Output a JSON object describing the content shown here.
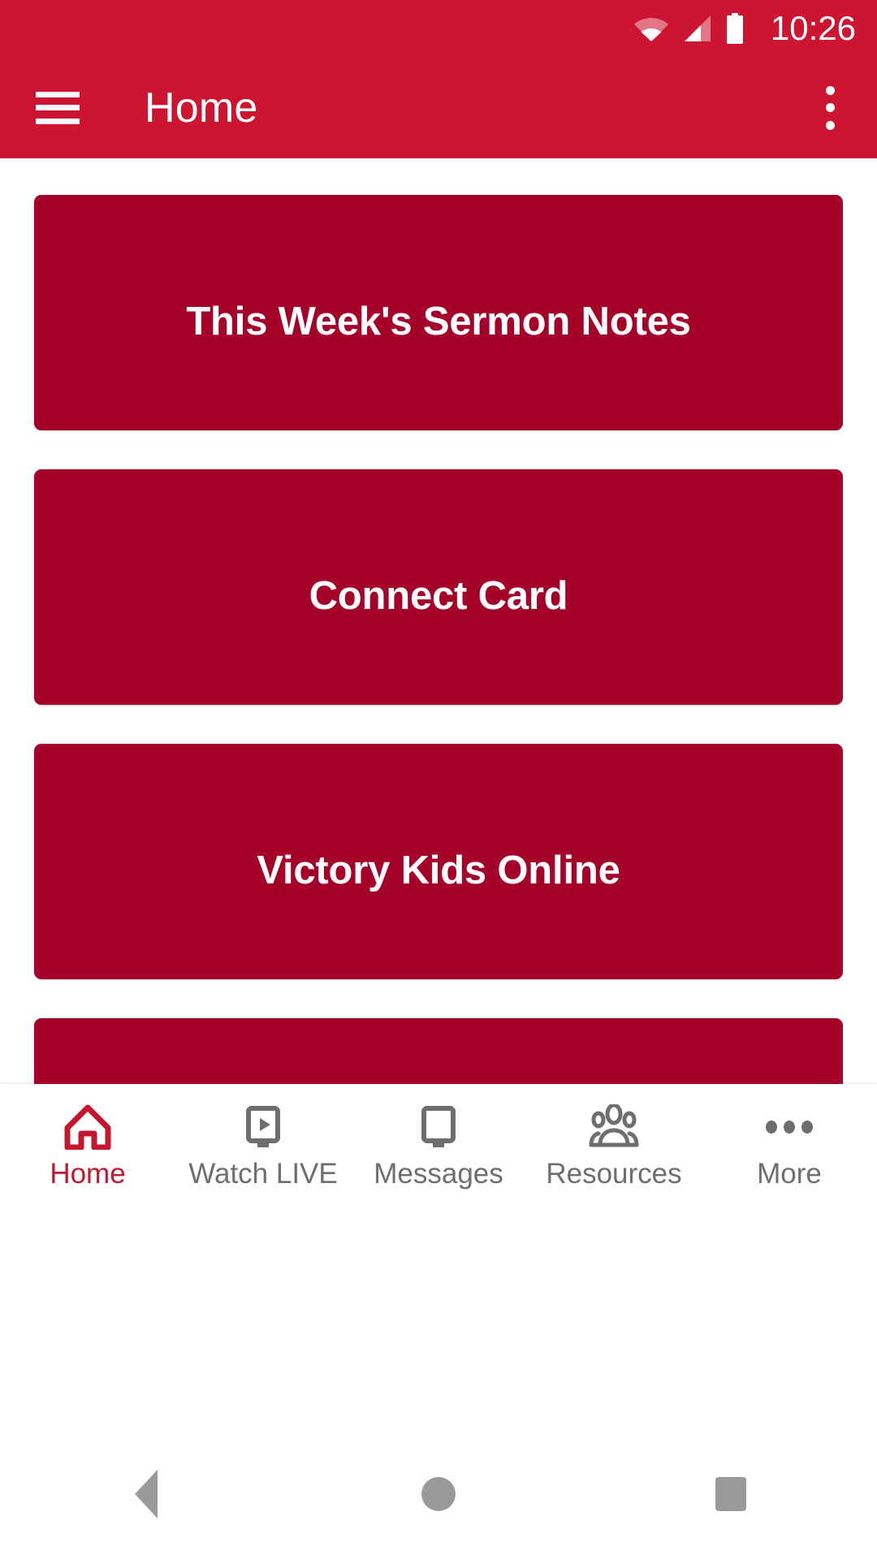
{
  "theme": {
    "appbar_color": "#CD1430",
    "card_color": "#A50229",
    "accent_color": "#C4162F",
    "nav_inactive_color": "#6E6E6E",
    "page_background": "#FFFFFF"
  },
  "statusbar": {
    "time": "10:26",
    "icons": [
      "wifi-icon",
      "cellular-signal-icon",
      "battery-icon"
    ]
  },
  "appbar": {
    "menu_icon": "hamburger-menu-icon",
    "title": "Home",
    "overflow_icon": "more-vert-icon"
  },
  "main": {
    "cards": [
      {
        "label": "This Week's Sermon Notes"
      },
      {
        "label": "Connect Card"
      },
      {
        "label": "Victory Kids Online"
      },
      {
        "label": ""
      }
    ]
  },
  "bottom_nav": {
    "items": [
      {
        "label": "Home",
        "icon": "home-icon",
        "active": true
      },
      {
        "label": "Watch LIVE",
        "icon": "tv-play-icon",
        "active": false
      },
      {
        "label": "Messages",
        "icon": "monitor-icon",
        "active": false
      },
      {
        "label": "Resources",
        "icon": "people-icon",
        "active": false
      },
      {
        "label": "More",
        "icon": "more-horiz-icon",
        "active": false
      }
    ]
  },
  "system_nav": {
    "back": "back-triangle-icon",
    "home": "home-circle-icon",
    "recents": "recents-square-icon"
  }
}
